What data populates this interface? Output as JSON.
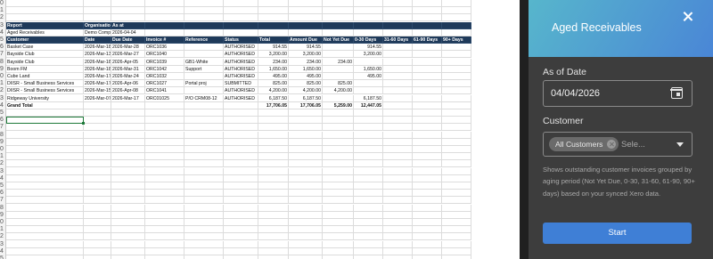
{
  "sheet": {
    "row_numbers": [
      "0",
      "1",
      "2",
      "3",
      "4",
      "5",
      "6",
      "7",
      "8",
      "9",
      "0",
      "1",
      "2",
      "3",
      "4",
      "5",
      "6",
      "7",
      "8",
      "9",
      "0",
      "1",
      "2",
      "3",
      "4",
      "5",
      "6",
      "7",
      "8",
      "9",
      "0",
      "1",
      "2",
      "3",
      "4",
      "5"
    ],
    "meta_header": [
      "Report",
      "Organisation",
      "As at"
    ],
    "meta_values": [
      "Aged Receivables",
      "Demo Company (AU)",
      "2026-04-04"
    ],
    "columns": [
      "Customer",
      "Date",
      "Due Date",
      "Invoice #",
      "Reference",
      "Status",
      "Total",
      "Amount Due",
      "Not Yet Due",
      "0-30 Days",
      "31-60 Days",
      "61-90 Days",
      "90+ Days"
    ],
    "rows": [
      [
        "Basket Case",
        "2026-Mar-18",
        "2026-Mar-28",
        "ORC1036",
        "",
        "AUTHORISED",
        "914.55",
        "914.55",
        "",
        "914.55",
        "",
        "",
        ""
      ],
      [
        "Bayside Club",
        "2026-Mar-13",
        "2026-Mar-27",
        "ORC1040",
        "",
        "AUTHORISED",
        "3,200.00",
        "3,200.00",
        "",
        "3,200.00",
        "",
        "",
        ""
      ],
      [
        "Bayside Club",
        "2026-Mar-18",
        "2026-Apr-05",
        "ORC1039",
        "GB1-White",
        "AUTHORISED",
        "234.00",
        "234.00",
        "234.00",
        "",
        "",
        "",
        ""
      ],
      [
        "Boom FM",
        "2026-Mar-18",
        "2026-Mar-31",
        "ORC1042",
        "Support",
        "AUTHORISED",
        "1,650.00",
        "1,650.00",
        "",
        "1,650.00",
        "",
        "",
        ""
      ],
      [
        "Cube Land",
        "2026-Mar-17",
        "2026-Mar-24",
        "ORC1032",
        "",
        "AUTHORISED",
        "495.00",
        "495.00",
        "",
        "495.00",
        "",
        "",
        ""
      ],
      [
        "DIISR - Small Business Services",
        "2026-Mar-17",
        "2026-Apr-06",
        "ORC1027",
        "Portal proj",
        "SUBMITTED",
        "825.00",
        "825.00",
        "825.00",
        "",
        "",
        "",
        ""
      ],
      [
        "DIISR - Small Business Services",
        "2026-Mar-15",
        "2026-Apr-08",
        "ORC1041",
        "",
        "AUTHORISED",
        "4,200.00",
        "4,200.00",
        "4,200.00",
        "",
        "",
        "",
        ""
      ],
      [
        "Ridgeway University",
        "2026-Mar-07",
        "2026-Mar-17",
        "ORC01025",
        "P/O CRM08-12",
        "AUTHORISED",
        "6,187.50",
        "6,187.50",
        "",
        "6,187.50",
        "",
        "",
        ""
      ]
    ],
    "total_row": [
      "Grand Total",
      "",
      "",
      "",
      "",
      "",
      "17,706.05",
      "17,706.05",
      "5,259.00",
      "12,447.05",
      "",
      "",
      ""
    ]
  },
  "panel": {
    "title": "Aged Receivables",
    "as_of_label": "As of Date",
    "as_of_value": "04/04/2026",
    "customer_label": "Customer",
    "customer_chip": "All Customers",
    "customer_placeholder": "Sele...",
    "description": "Shows outstanding customer invoices grouped by aging period (Not Yet Due, 0-30, 31-60, 61-90, 90+ days) based on your synced Xero data.",
    "start_label": "Start"
  },
  "colors": {
    "header_fill": "#1f3a5a",
    "panel_bg": "#3d3d3d",
    "header_gradient_start": "#57b6cc",
    "header_gradient_end": "#4a86d6",
    "start_button": "#3f7fd6",
    "selection": "#1e7a3a"
  },
  "icons": [
    "close-icon",
    "calendar-icon",
    "chip-remove-icon",
    "dropdown-caret-icon"
  ]
}
